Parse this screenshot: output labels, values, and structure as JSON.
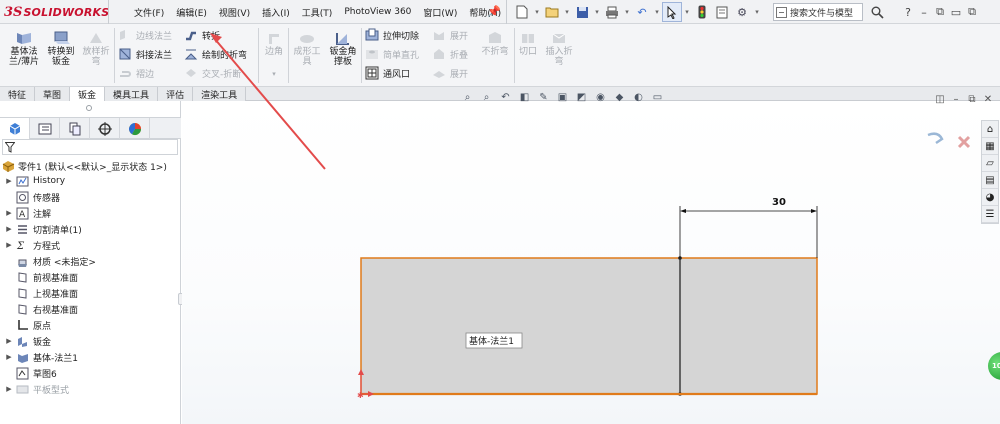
{
  "app": {
    "logo_prefix": "3S",
    "logo_text": "SOLIDWORKS"
  },
  "menu": [
    "文件(F)",
    "编辑(E)",
    "视图(V)",
    "插入(I)",
    "工具(T)",
    "PhotoView 360",
    "窗口(W)",
    "帮助(H)"
  ],
  "search": {
    "label": "搜索文件与模型"
  },
  "ribbon": {
    "base_flange": "基体法兰/薄片",
    "base_flange_l1": "基体法",
    "base_flange_l2": "兰/薄片",
    "convert": "转换到钣金",
    "convert_l1": "转换到",
    "convert_l2": "钣金",
    "lofted_l1": "放样折",
    "lofted_l2": "弯",
    "edge_flange": "边线法兰",
    "miter_flange": "斜接法兰",
    "hem": "褶边",
    "jog": "转折",
    "sketched_bend": "绘制的折弯",
    "cross_break": "交叉-折断",
    "corners": "边角",
    "forming_l1": "成形工",
    "forming_l2": "具",
    "gusset_l1": "钣金角",
    "gusset_l2": "撑板",
    "extruded_cut": "拉伸切除",
    "simple_hole": "简单直孔",
    "vent": "通风口",
    "unfold": "展开",
    "fold": "折叠",
    "flatten": "展开",
    "no_bends": "不折弯",
    "rip": "切口",
    "insert_bends_l1": "插入折",
    "insert_bends_l2": "弯"
  },
  "tabs": [
    "特征",
    "草图",
    "钣金",
    "模具工具",
    "评估",
    "渲染工具"
  ],
  "active_tab": "钣金",
  "tree": {
    "root": "零件1 (默认<<默认>_显示状态 1>)",
    "items": [
      {
        "label": "History",
        "expandable": true,
        "icon": "history-icon"
      },
      {
        "label": "传感器",
        "expandable": false,
        "icon": "sensor-icon"
      },
      {
        "label": "注解",
        "expandable": true,
        "icon": "annotation-icon"
      },
      {
        "label": "切割清单(1)",
        "expandable": true,
        "icon": "cutlist-icon"
      },
      {
        "label": "方程式",
        "expandable": true,
        "icon": "equation-icon"
      },
      {
        "label": "材质 <未指定>",
        "expandable": false,
        "icon": "material-icon"
      },
      {
        "label": "前视基准面",
        "expandable": false,
        "icon": "plane-icon"
      },
      {
        "label": "上视基准面",
        "expandable": false,
        "icon": "plane-icon"
      },
      {
        "label": "右视基准面",
        "expandable": false,
        "icon": "plane-icon"
      },
      {
        "label": "原点",
        "expandable": false,
        "icon": "origin-icon"
      },
      {
        "label": "钣金",
        "expandable": true,
        "icon": "sheetmetal-icon"
      },
      {
        "label": "基体-法兰1",
        "expandable": true,
        "icon": "baseflange-icon"
      },
      {
        "label": "草图6",
        "expandable": false,
        "icon": "sketch-icon"
      },
      {
        "label": "平板型式",
        "expandable": true,
        "icon": "flatpattern-icon",
        "disabled": true
      }
    ]
  },
  "drawing": {
    "dimension": "30",
    "feature_label": "基体-法兰1"
  },
  "colors": {
    "brand": "#c8102e",
    "sketch_line": "#e07b1b",
    "part_fill": "#d5d5d5",
    "arrow": "#e34b4b"
  }
}
